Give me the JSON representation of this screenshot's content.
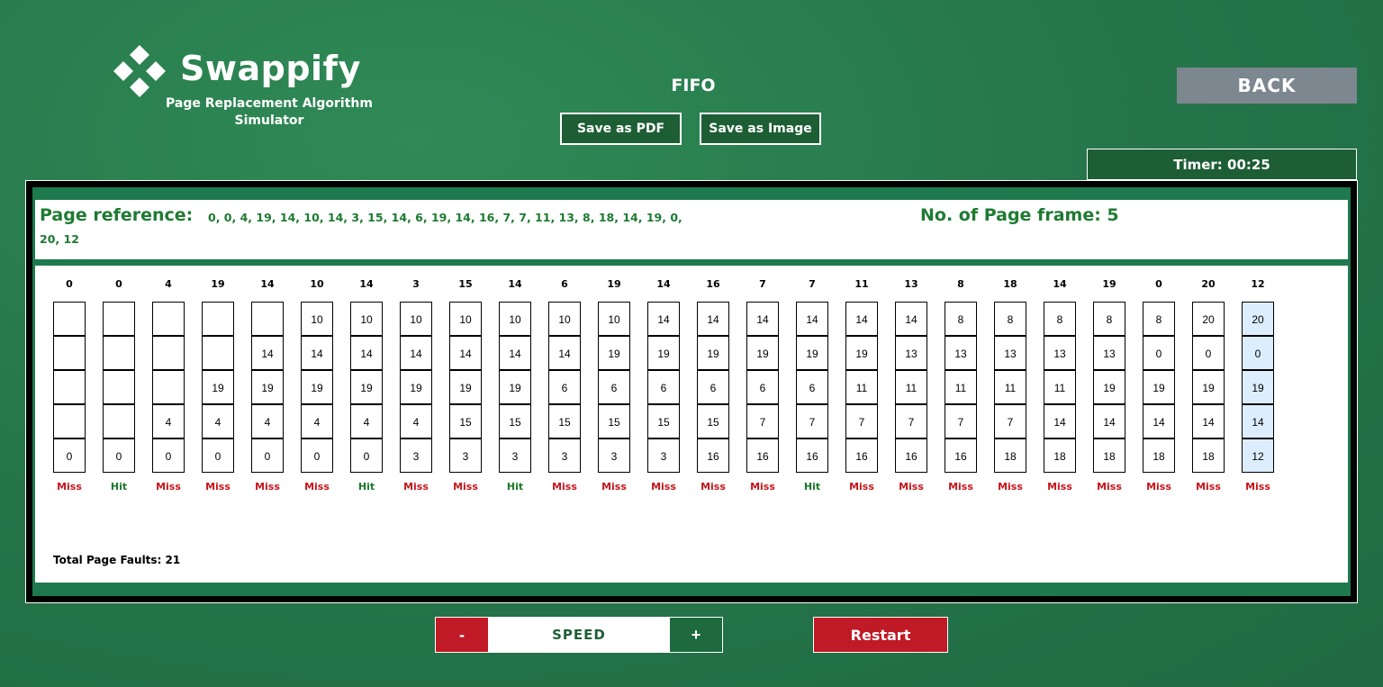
{
  "app": {
    "name": "Swappify",
    "subtitle": "Page Replacement Algorithm Simulator",
    "logo_icon": "four-diamonds-icon"
  },
  "header": {
    "algorithm": "FIFO",
    "save_pdf_label": "Save as PDF",
    "save_image_label": "Save as Image",
    "back_label": "BACK",
    "timer": "Timer: 00:25"
  },
  "reference": {
    "label": "Page reference:",
    "sequence": "0, 0, 4, 19, 14, 10, 14, 3, 15, 14, 6, 19, 14, 16, 7, 7, 11, 13, 8, 18, 14, 19, 0, 20, 12",
    "frames_label": "No. of Page frame: 5"
  },
  "simulation": {
    "columns": [
      {
        "page": "0",
        "frames": [
          "",
          "",
          "",
          "",
          "0"
        ],
        "result": "Miss"
      },
      {
        "page": "0",
        "frames": [
          "",
          "",
          "",
          "",
          "0"
        ],
        "result": "Hit"
      },
      {
        "page": "4",
        "frames": [
          "",
          "",
          "",
          "4",
          "0"
        ],
        "result": "Miss"
      },
      {
        "page": "19",
        "frames": [
          "",
          "",
          "19",
          "4",
          "0"
        ],
        "result": "Miss"
      },
      {
        "page": "14",
        "frames": [
          "",
          "14",
          "19",
          "4",
          "0"
        ],
        "result": "Miss"
      },
      {
        "page": "10",
        "frames": [
          "10",
          "14",
          "19",
          "4",
          "0"
        ],
        "result": "Miss"
      },
      {
        "page": "14",
        "frames": [
          "10",
          "14",
          "19",
          "4",
          "0"
        ],
        "result": "Hit"
      },
      {
        "page": "3",
        "frames": [
          "10",
          "14",
          "19",
          "4",
          "3"
        ],
        "result": "Miss"
      },
      {
        "page": "15",
        "frames": [
          "10",
          "14",
          "19",
          "15",
          "3"
        ],
        "result": "Miss"
      },
      {
        "page": "14",
        "frames": [
          "10",
          "14",
          "19",
          "15",
          "3"
        ],
        "result": "Hit"
      },
      {
        "page": "6",
        "frames": [
          "10",
          "14",
          "6",
          "15",
          "3"
        ],
        "result": "Miss"
      },
      {
        "page": "19",
        "frames": [
          "10",
          "19",
          "6",
          "15",
          "3"
        ],
        "result": "Miss"
      },
      {
        "page": "14",
        "frames": [
          "14",
          "19",
          "6",
          "15",
          "3"
        ],
        "result": "Miss"
      },
      {
        "page": "16",
        "frames": [
          "14",
          "19",
          "6",
          "15",
          "16"
        ],
        "result": "Miss"
      },
      {
        "page": "7",
        "frames": [
          "14",
          "19",
          "6",
          "7",
          "16"
        ],
        "result": "Miss"
      },
      {
        "page": "7",
        "frames": [
          "14",
          "19",
          "6",
          "7",
          "16"
        ],
        "result": "Hit"
      },
      {
        "page": "11",
        "frames": [
          "14",
          "19",
          "11",
          "7",
          "16"
        ],
        "result": "Miss"
      },
      {
        "page": "13",
        "frames": [
          "14",
          "13",
          "11",
          "7",
          "16"
        ],
        "result": "Miss"
      },
      {
        "page": "8",
        "frames": [
          "8",
          "13",
          "11",
          "7",
          "16"
        ],
        "result": "Miss"
      },
      {
        "page": "18",
        "frames": [
          "8",
          "13",
          "11",
          "7",
          "18"
        ],
        "result": "Miss"
      },
      {
        "page": "14",
        "frames": [
          "8",
          "13",
          "11",
          "14",
          "18"
        ],
        "result": "Miss"
      },
      {
        "page": "19",
        "frames": [
          "8",
          "13",
          "19",
          "14",
          "18"
        ],
        "result": "Miss"
      },
      {
        "page": "0",
        "frames": [
          "8",
          "0",
          "19",
          "14",
          "18"
        ],
        "result": "Miss"
      },
      {
        "page": "20",
        "frames": [
          "20",
          "0",
          "19",
          "14",
          "18"
        ],
        "result": "Miss"
      },
      {
        "page": "12",
        "frames": [
          "20",
          "0",
          "19",
          "14",
          "12"
        ],
        "result": "Miss"
      }
    ],
    "total_faults": "Total Page Faults: 21",
    "colors": {
      "miss": "#c4161c",
      "hit": "#1c7a2c",
      "current_column": "#dceefd"
    }
  },
  "controls": {
    "speed_minus": "-",
    "speed_label": "SPEED",
    "speed_plus": "+",
    "restart_label": "Restart"
  }
}
